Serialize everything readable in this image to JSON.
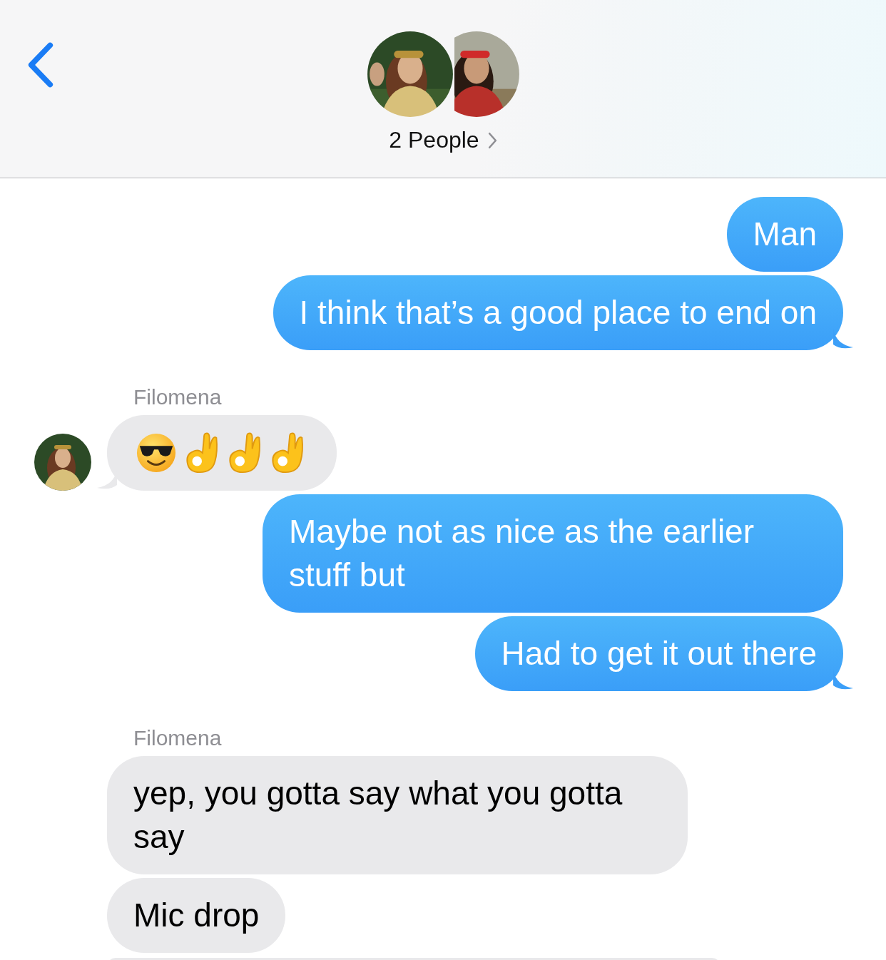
{
  "header": {
    "title": "2 People"
  },
  "thread": [
    {
      "kind": "text",
      "sent": true,
      "text": "Man",
      "tail": false
    },
    {
      "kind": "text",
      "sent": true,
      "text": "I think that’s a good place to end on",
      "tail": true
    },
    {
      "kind": "sender",
      "text": "Filomena"
    },
    {
      "kind": "emoji",
      "sent": false,
      "tail": true,
      "avatar": true
    },
    {
      "kind": "text",
      "sent": true,
      "text": "Maybe not as nice as the earlier stuff but",
      "tail": false
    },
    {
      "kind": "text",
      "sent": true,
      "text": "Had to get it out there",
      "tail": true
    },
    {
      "kind": "sender",
      "text": "Filomena"
    },
    {
      "kind": "text",
      "sent": false,
      "text": "yep, you gotta say what you gotta say",
      "tail": false
    },
    {
      "kind": "text",
      "sent": false,
      "text": "Mic drop",
      "tail": false
    },
    {
      "kind": "clipped",
      "sent": false
    }
  ]
}
